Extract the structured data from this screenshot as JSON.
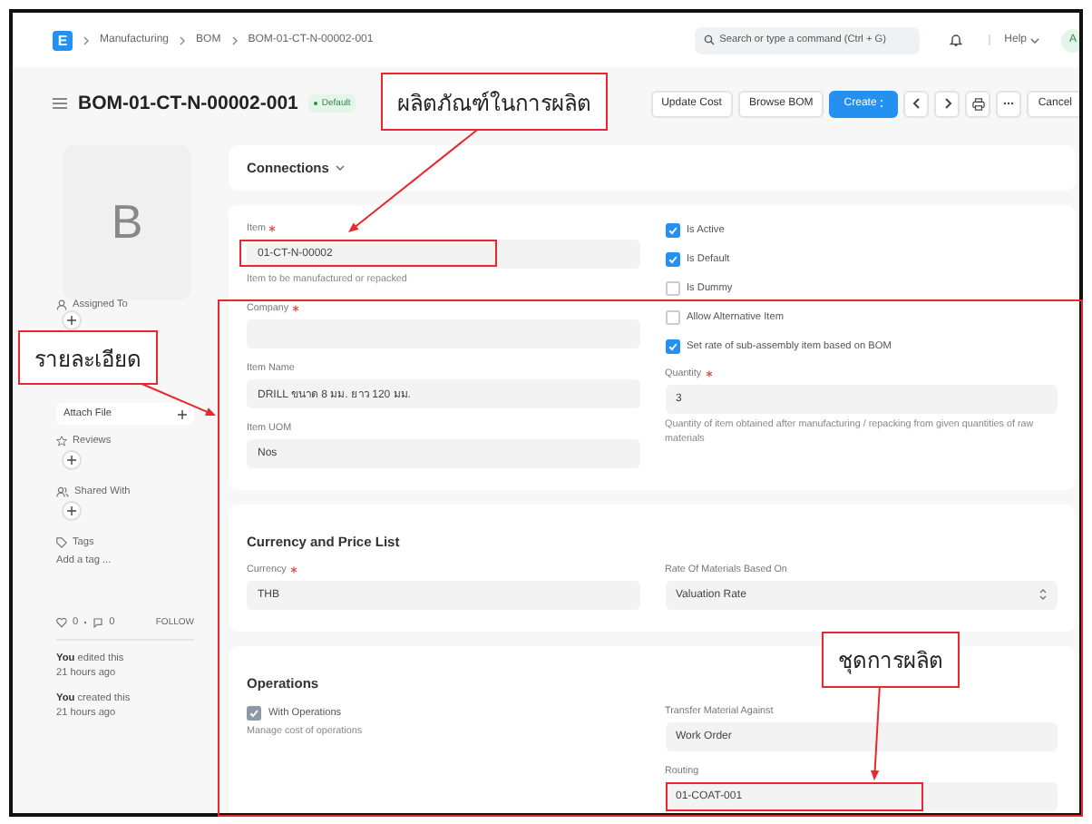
{
  "navbar": {
    "logo": "E",
    "breadcrumbs": [
      "Manufacturing",
      "BOM",
      "BOM-01-CT-N-00002-001"
    ],
    "search": {
      "placeholder": "Search or type a command (Ctrl + G)"
    },
    "help": "Help",
    "avatar": "A"
  },
  "header": {
    "title": "BOM-01-CT-N-00002-001",
    "badge": "Default",
    "buttons": [
      {
        "label": "Update Cost",
        "kind": "plain"
      },
      {
        "label": "Browse BOM",
        "kind": "plain"
      },
      {
        "label": "Create",
        "kind": "primary"
      },
      {
        "kind": "prev"
      },
      {
        "kind": "next"
      },
      {
        "kind": "print"
      },
      {
        "kind": "more"
      },
      {
        "label": "Cancel",
        "kind": "plain"
      }
    ]
  },
  "sidebar": {
    "image_letter": "B",
    "assigned_to": "Assigned To",
    "attach_file": "Attach File",
    "reviews": "Reviews",
    "shared_with": "Shared With",
    "tags": "Tags",
    "add_tag": "Add a tag ...",
    "likes": "0",
    "comments": "0",
    "follow": "FOLLOW",
    "activity": [
      {
        "who": "You",
        "what": "edited this",
        "when": "21 hours ago"
      },
      {
        "who": "You",
        "what": "created this",
        "when": "21 hours ago"
      }
    ]
  },
  "sections": [
    {
      "kind": "connections",
      "title": "Connections"
    },
    {
      "kind": "form",
      "left": [
        {
          "kind": "field",
          "label": "Item",
          "required": true,
          "value": "01-CT-N-00002",
          "description": "Item to be manufactured or repacked"
        },
        {
          "kind": "field",
          "label": "Company",
          "required": true
        },
        {
          "kind": "field",
          "label": "Item Name",
          "required": false,
          "value": "DRILL ขนาด 8 มม. ยาว 120 มม."
        },
        {
          "kind": "field",
          "label": "Item UOM",
          "required": false,
          "value": "Nos"
        }
      ],
      "right": [
        {
          "kind": "check",
          "label": "Is Active",
          "checked": true
        },
        {
          "kind": "check",
          "label": "Is Default",
          "checked": true
        },
        {
          "kind": "check",
          "label": "Is Dummy",
          "checked": false
        },
        {
          "kind": "check",
          "label": "Allow Alternative Item",
          "checked": false
        },
        {
          "kind": "check",
          "label": "Set rate of sub-assembly item based on BOM",
          "checked": true
        },
        {
          "kind": "field",
          "label": "Quantity",
          "required": true,
          "value": "3",
          "description": "Quantity of item obtained after manufacturing / repacking from given quantities of raw materials"
        }
      ]
    },
    {
      "kind": "form",
      "title": "Currency and Price List",
      "left": [
        {
          "kind": "field",
          "label": "Currency",
          "required": true,
          "value": "THB"
        }
      ],
      "right": [
        {
          "kind": "select",
          "label": "Rate Of Materials Based On",
          "value": "Valuation Rate"
        }
      ]
    },
    {
      "kind": "form",
      "title": "Operations",
      "left": [
        {
          "kind": "check",
          "label": "With Operations",
          "checked": true,
          "description": "Manage cost of operations"
        }
      ],
      "right": [
        {
          "kind": "field",
          "label": "Transfer Material Against",
          "required": false,
          "value": "Work Order"
        },
        {
          "kind": "field",
          "label": "Routing",
          "required": false,
          "value": "01-COAT-001"
        }
      ]
    }
  ],
  "annotations": {
    "callouts": [
      "ผลิตภัณฑ์ในการผลิต",
      "รายละเอียด",
      "ชุดการผลิต"
    ]
  }
}
